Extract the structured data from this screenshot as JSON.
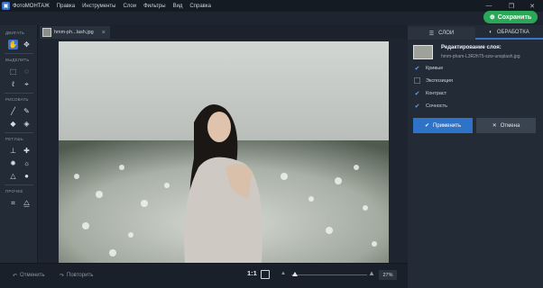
{
  "app": {
    "title": "ФотоМОНТАЖ",
    "menu": [
      "Правка",
      "Инструменты",
      "Слои",
      "Фильтры",
      "Вид",
      "Справка"
    ],
    "save_label": "Сохранить"
  },
  "toolbar": {
    "sections": [
      {
        "label": "ДВИГАТЬ",
        "icons": [
          "hand-icon",
          "move-icon"
        ]
      },
      {
        "label": "ВЫДЕЛИТЬ",
        "icons": [
          "rect-select-icon",
          "ellipse-select-icon",
          "lasso-icon",
          "polygon-lasso-icon"
        ]
      },
      {
        "label": "РИСОВАТЬ",
        "icons": [
          "brush-icon",
          "pencil-icon",
          "eraser-icon",
          "fill-icon"
        ]
      },
      {
        "label": "РЕТУШЬ",
        "icons": [
          "stamp-icon",
          "healing-icon",
          "dodge-icon",
          "burn-icon",
          "sharpen-icon",
          "blur-icon"
        ]
      },
      {
        "label": "ПРОЧЕЕ",
        "icons": [
          "crop-icon",
          "shapes-icon"
        ]
      }
    ]
  },
  "document": {
    "tab_name": "hmm-ph...lash.jpg"
  },
  "bottom": {
    "undo_label": "Отменить",
    "redo_label": "Повторить",
    "zoom_ratio": "1:1",
    "zoom_percent": "27%",
    "zoom_level": 0.02
  },
  "panel": {
    "tabs": {
      "layers": "СЛОИ",
      "processing": "ОБРАБОТКА"
    },
    "active_tab": "ОБРАБОТКА",
    "layer_title": "Редактирование слоя:",
    "layer_file": "hmm-pham-L3R2hT5-szw-unsplash.jpg",
    "options": [
      {
        "label": "Кривые",
        "checked": true
      },
      {
        "label": "Экспозиция",
        "checked": false
      },
      {
        "label": "Контраст",
        "checked": true
      },
      {
        "label": "Сочность",
        "checked": true
      }
    ],
    "apply_label": "Применить",
    "cancel_label": "Отмена"
  },
  "colors": {
    "accent": "#3a73c9",
    "save": "#2aa857",
    "background": "#1e2530"
  }
}
